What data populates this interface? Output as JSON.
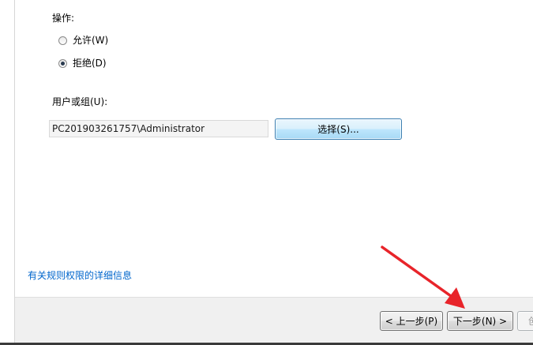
{
  "action": {
    "label": "操作:",
    "options": [
      {
        "label": "允许(W)",
        "checked": false
      },
      {
        "label": "拒绝(D)",
        "checked": true
      }
    ]
  },
  "user_group": {
    "label": "用户或组(U):",
    "value": "PC201903261757\\Administrator",
    "select_button_label": "选择(S)..."
  },
  "learn_more_link": "有关规则权限的详细信息",
  "footer": {
    "back_label": "< 上一步(P)",
    "next_label": "下一步(N) >",
    "create_label_partial": "创"
  },
  "colors": {
    "link": "#0066cc",
    "annotation_arrow": "#e8242a",
    "select_button_border": "#3c7fb1"
  },
  "icons": {
    "annotation": "red-arrow-icon",
    "radio_unchecked": "radio-unchecked-icon",
    "radio_checked": "radio-checked-icon"
  }
}
